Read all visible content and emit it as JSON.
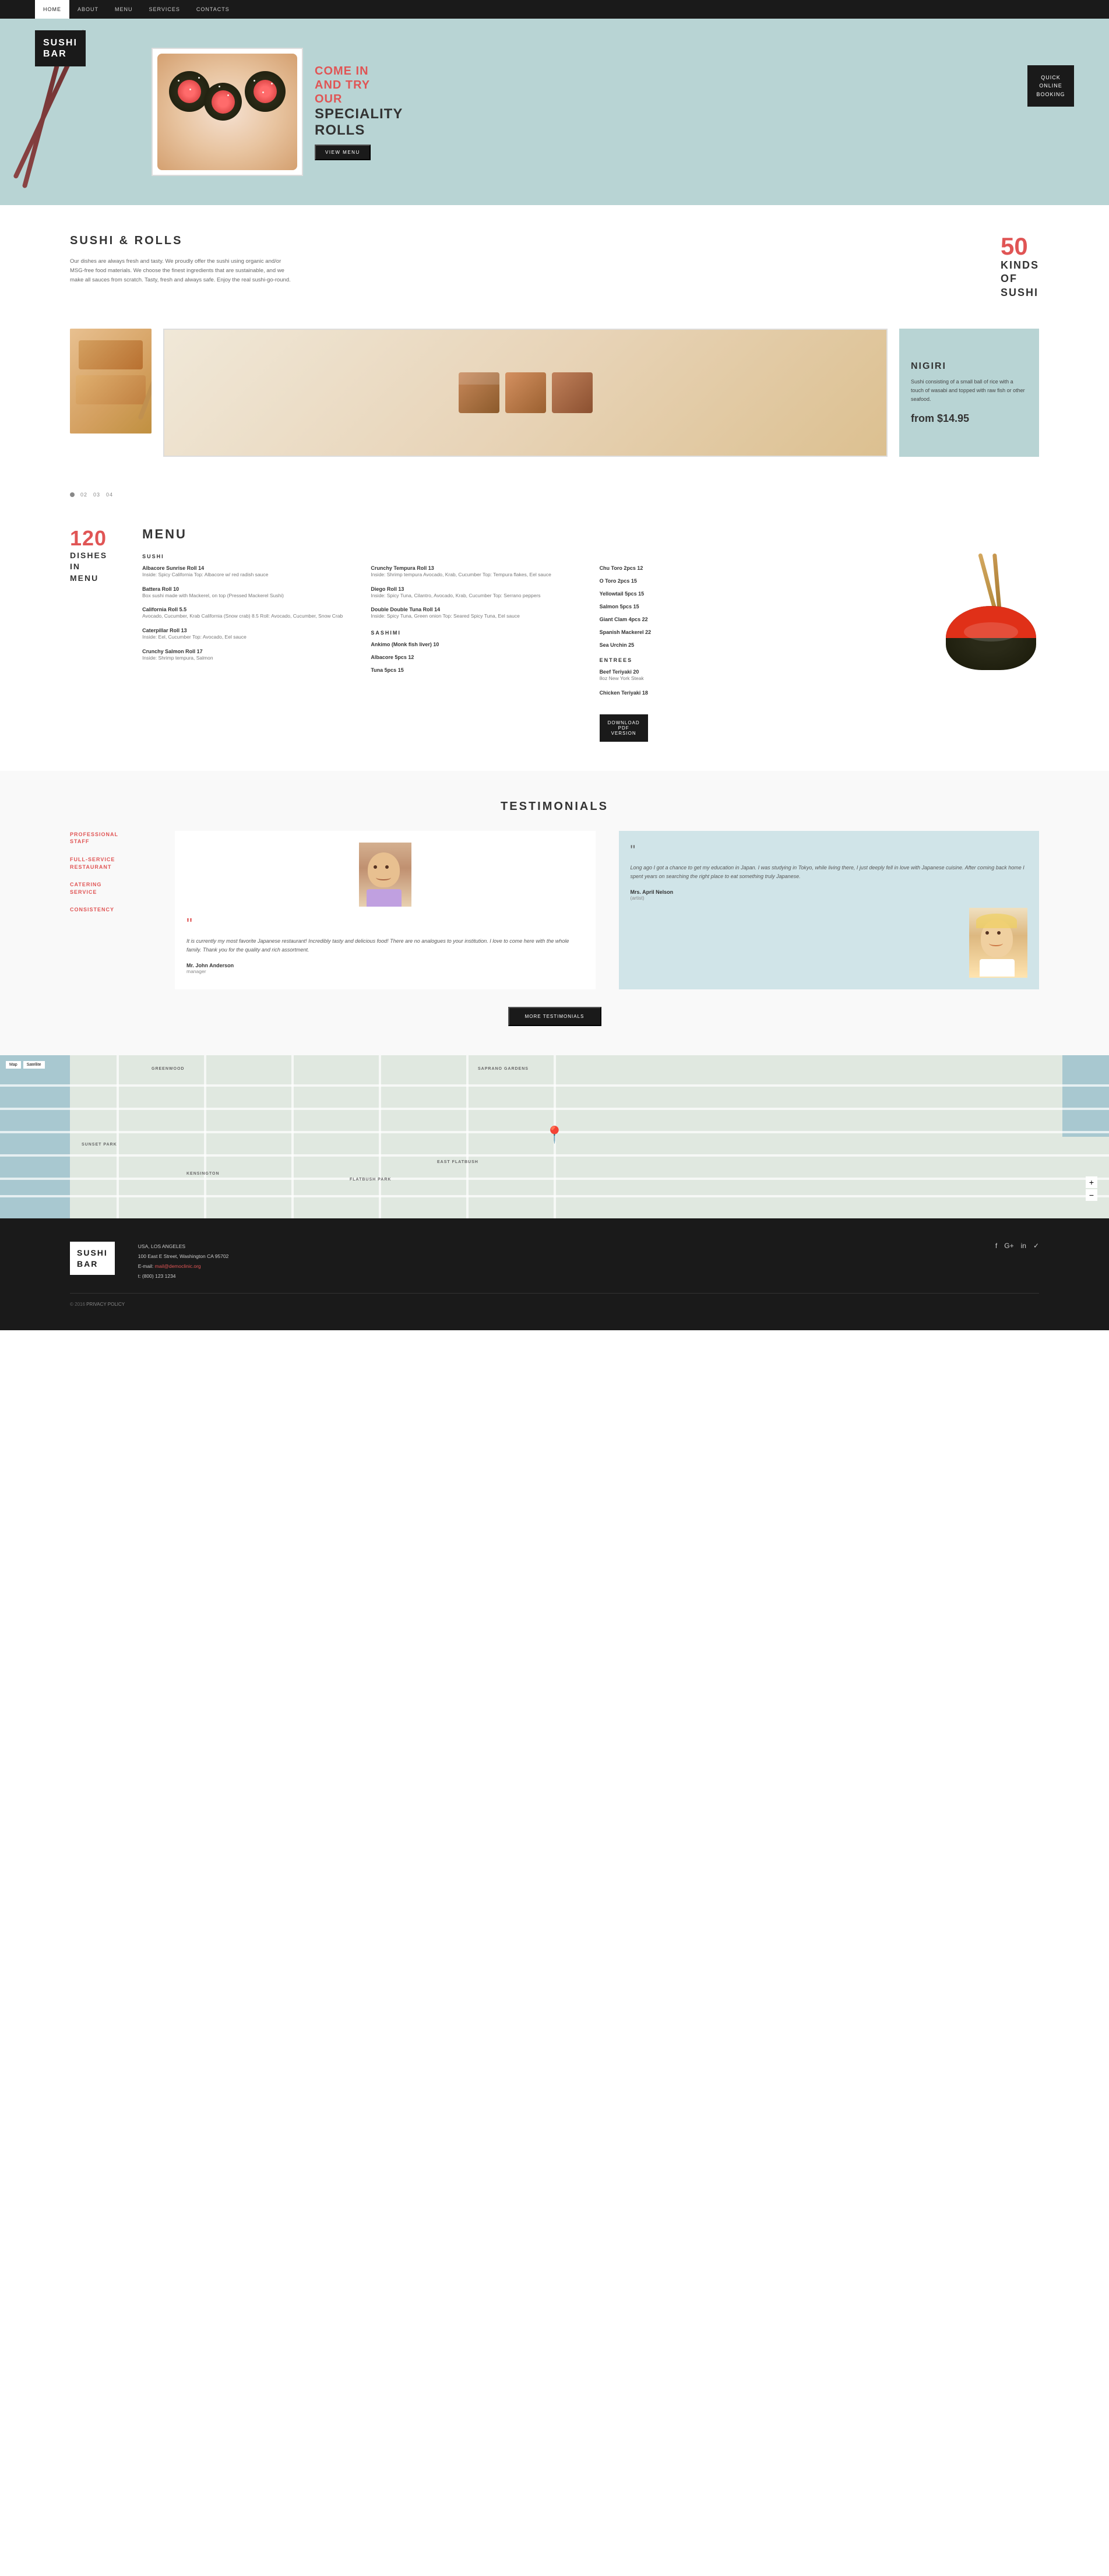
{
  "nav": {
    "items": [
      {
        "label": "HOME",
        "active": true
      },
      {
        "label": "ABOUT",
        "active": false
      },
      {
        "label": "MENU",
        "active": false
      },
      {
        "label": "SERVICES",
        "active": false
      },
      {
        "label": "CONTACTS",
        "active": false
      }
    ]
  },
  "logo": {
    "line1": "SUSHI",
    "line2": "BAR"
  },
  "hero": {
    "tagline": "COME IN\nAND TRY\nOUR",
    "subtitle_bold": "SPECIALITY\nROLLS",
    "view_menu": "VIEW MENU",
    "booking": "QUICK\nONLINE\nBOOKING"
  },
  "sushi_rolls": {
    "title": "SUSHI & ROLLS",
    "description": "Our dishes are always fresh and tasty. We proudly offer the sushi using organic and/or MSG-free food materials. We choose the finest ingredients that are sustainable, and we make all sauces from scratch. Tasty, fresh and always safe. Enjoy the real sushi-go-round.",
    "count": "50",
    "count_label": "KINDS\nOF\nSUSHI"
  },
  "nigiri": {
    "title": "NIGIRI",
    "description": "Sushi consisting of a small ball of rice with a touch of wasabi and topped with raw fish or other seafood.",
    "price": "from $14.95"
  },
  "slider": {
    "dots": [
      "01",
      "02",
      "03",
      "04"
    ]
  },
  "menu": {
    "count": "120",
    "count_label": "DISHES\nIN\nMENU",
    "title": "MENU",
    "sushi_label": "SUSHI",
    "items_col1": [
      {
        "name": "Albacore Sunrise Roll 14",
        "desc": "Inside: Spicy California\nTop: Albacore w/ red radish sauce"
      },
      {
        "name": "Battera Roll 10",
        "desc": "Box sushi made with Mackerel, on top (Pressed Mackerel Sushi)"
      },
      {
        "name": "California Roll 5.5",
        "desc": "Avocado, Cucumber, Krab\nCalifornia (Snow crab) 8.5\nRoll: Avocado, Cucumber, Snow Crab"
      },
      {
        "name": "Caterpillar Roll 13",
        "desc": "Inside: Eel, Cucumber Top:\nAvocado, Eel sauce"
      },
      {
        "name": "Crunchy Salmon Roll 17",
        "desc": "Inside: Shrimp tempura,\nSalmon"
      }
    ],
    "items_col2": [
      {
        "name": "Crunchy Tempura Roll 13",
        "desc": "Inside: Shrimp tempura\nAvocado, Krab, Cucumber\nTop: Tempura flakes, Eel sauce"
      },
      {
        "name": "Diego Roll 13",
        "desc": "Inside: Spicy Tuna, Cilantro,\nAvocado, Krab, Cucumber\nTop: Serrano peppers"
      },
      {
        "name": "Double Double Tuna Roll 14",
        "desc": "Inside: Spicy Tuna, Green\nonion\nTop: Seared Spicy Tuna,\nEel sauce"
      }
    ],
    "sashimi_label": "SASHIMI",
    "sashimi_items": [
      {
        "name": "Ankimo (Monk fish liver) 10"
      },
      {
        "name": "Albacore 5pcs 12"
      },
      {
        "name": "Tuna 5pcs 15"
      }
    ],
    "items_col4": [
      {
        "name": "Chu Toro 2pcs 12"
      },
      {
        "name": "O Toro 2pcs 15"
      },
      {
        "name": "Yellowtail 5pcs 15"
      },
      {
        "name": "Salmon 5pcs 15"
      },
      {
        "name": "Giant Clam 4pcs 22"
      },
      {
        "name": "Spanish Mackerel 22"
      },
      {
        "name": "Sea Urchin 25"
      }
    ],
    "entrees_label": "ENTREES",
    "entrees_items": [
      {
        "name": "Beef Teriyaki 20",
        "desc": "8oz New York Steak"
      },
      {
        "name": "Chicken Teriyaki 18"
      }
    ],
    "download_btn": "DOWNLOAD\nPDF\nVERSION"
  },
  "testimonials": {
    "title": "TESTIMONIALS",
    "features": [
      {
        "label": "PROFESSIONAL\nSTAFF"
      },
      {
        "label": "FULL-SERVICE\nRESTAURANT"
      },
      {
        "label": "CATERING\nSERVICE"
      },
      {
        "label": "CONSISTENCY"
      }
    ],
    "card1": {
      "quote": "It is currently my most favorite Japanese restaurant! Incredibly tasty and delicious food! There are no analogues to your institution. I love to come here with the whole family. Thank you for the quality and rich assortment.",
      "name": "Mr. John Anderson",
      "role": "manager"
    },
    "card2": {
      "quote": "Long ago I got a chance to get my education in Japan. I was studying in Tokyo, while living there, I just deeply fell in love with Japanese cuisine. After coming back home I spent years on searching the right place to eat something truly Japanese.",
      "name": "Mrs. April Nelson",
      "role": "(artist)"
    },
    "more_btn": "MORE TESTIMONIALS"
  },
  "map": {
    "neighborhoods": [
      "GREENWOOD",
      "SUNSET PARK",
      "KENSINGTON",
      "EAST FLATBUSH",
      "FLATBUSH PARK",
      "SAPRANO GARDENS"
    ],
    "zoom_in": "+",
    "zoom_out": "−",
    "controls": [
      "Map",
      "Satellite"
    ]
  },
  "footer": {
    "logo_line1": "SUSHI",
    "logo_line2": "BAR",
    "location": "USA, LOS ANGELES",
    "address": "100 East E Street, Washington CA 95702",
    "email_label": "E-mail:",
    "email": "mail@democlinic.org",
    "phone_label": "t: (800) 123 1234",
    "social": [
      "f",
      "G+",
      "in",
      "✓"
    ],
    "copyright": "© 2016",
    "privacy": "PRIVACY POLICY"
  }
}
